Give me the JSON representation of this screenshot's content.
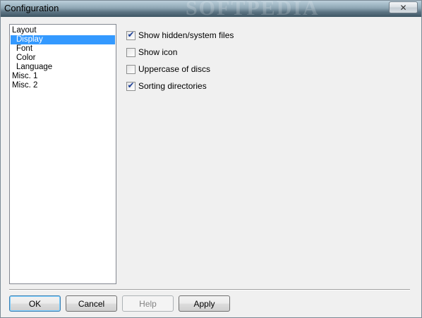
{
  "window": {
    "title": "Configuration",
    "close_glyph": "✕"
  },
  "tree": {
    "items": [
      {
        "label": "Layout",
        "level": 0,
        "selected": false
      },
      {
        "label": "Display",
        "level": 1,
        "selected": true
      },
      {
        "label": "Font",
        "level": 1,
        "selected": false
      },
      {
        "label": "Color",
        "level": 1,
        "selected": false
      },
      {
        "label": "Language",
        "level": 1,
        "selected": false
      },
      {
        "label": "Misc. 1",
        "level": 0,
        "selected": false
      },
      {
        "label": "Misc. 2",
        "level": 0,
        "selected": false
      }
    ]
  },
  "options": [
    {
      "label": "Show hidden/system files",
      "checked": true
    },
    {
      "label": "Show icon",
      "checked": false
    },
    {
      "label": "Uppercase of discs",
      "checked": false
    },
    {
      "label": "Sorting directories",
      "checked": true
    }
  ],
  "check_glyph": "✔",
  "buttons": {
    "ok": "OK",
    "cancel": "Cancel",
    "help": "Help",
    "apply": "Apply"
  },
  "colors": {
    "selection": "#3399ff",
    "dialog_bg": "#f0f0f0"
  }
}
